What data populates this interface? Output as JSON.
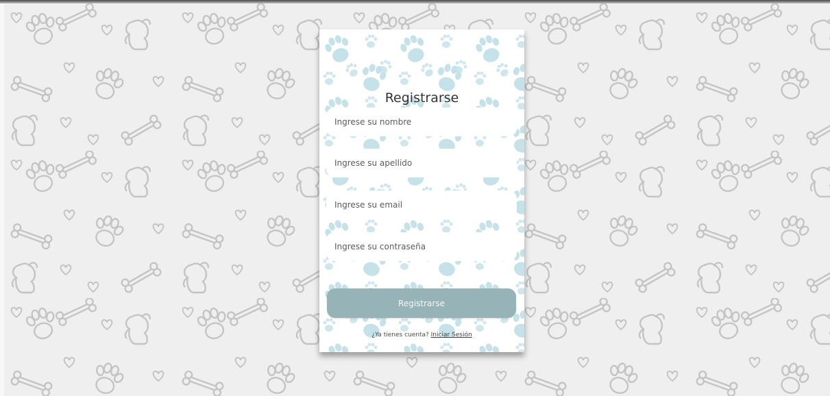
{
  "form": {
    "title": "Registrarse",
    "fields": [
      {
        "name": "nombre",
        "placeholder": "Ingrese su nombre",
        "value": ""
      },
      {
        "name": "apellido",
        "placeholder": "Ingrese su apellido",
        "value": ""
      },
      {
        "name": "email",
        "placeholder": "Ingrese su email",
        "value": ""
      },
      {
        "name": "contrasena",
        "placeholder": "Ingrese su contraseña",
        "value": ""
      }
    ],
    "submit_label": "Registrarse",
    "footer_prompt": "¿Ya tienes cuenta?",
    "login_link": "Iniciar Sesión"
  },
  "background": {
    "motifs": [
      "paw-icon",
      "bone-icon",
      "heart-icon",
      "dog-icon"
    ],
    "color": "#efefef",
    "motif_color": "#bfbfbf"
  },
  "card": {
    "pattern_motif": "paw-icon",
    "pattern_color": "#c8e3ea",
    "button_color": "#96b4b8"
  }
}
